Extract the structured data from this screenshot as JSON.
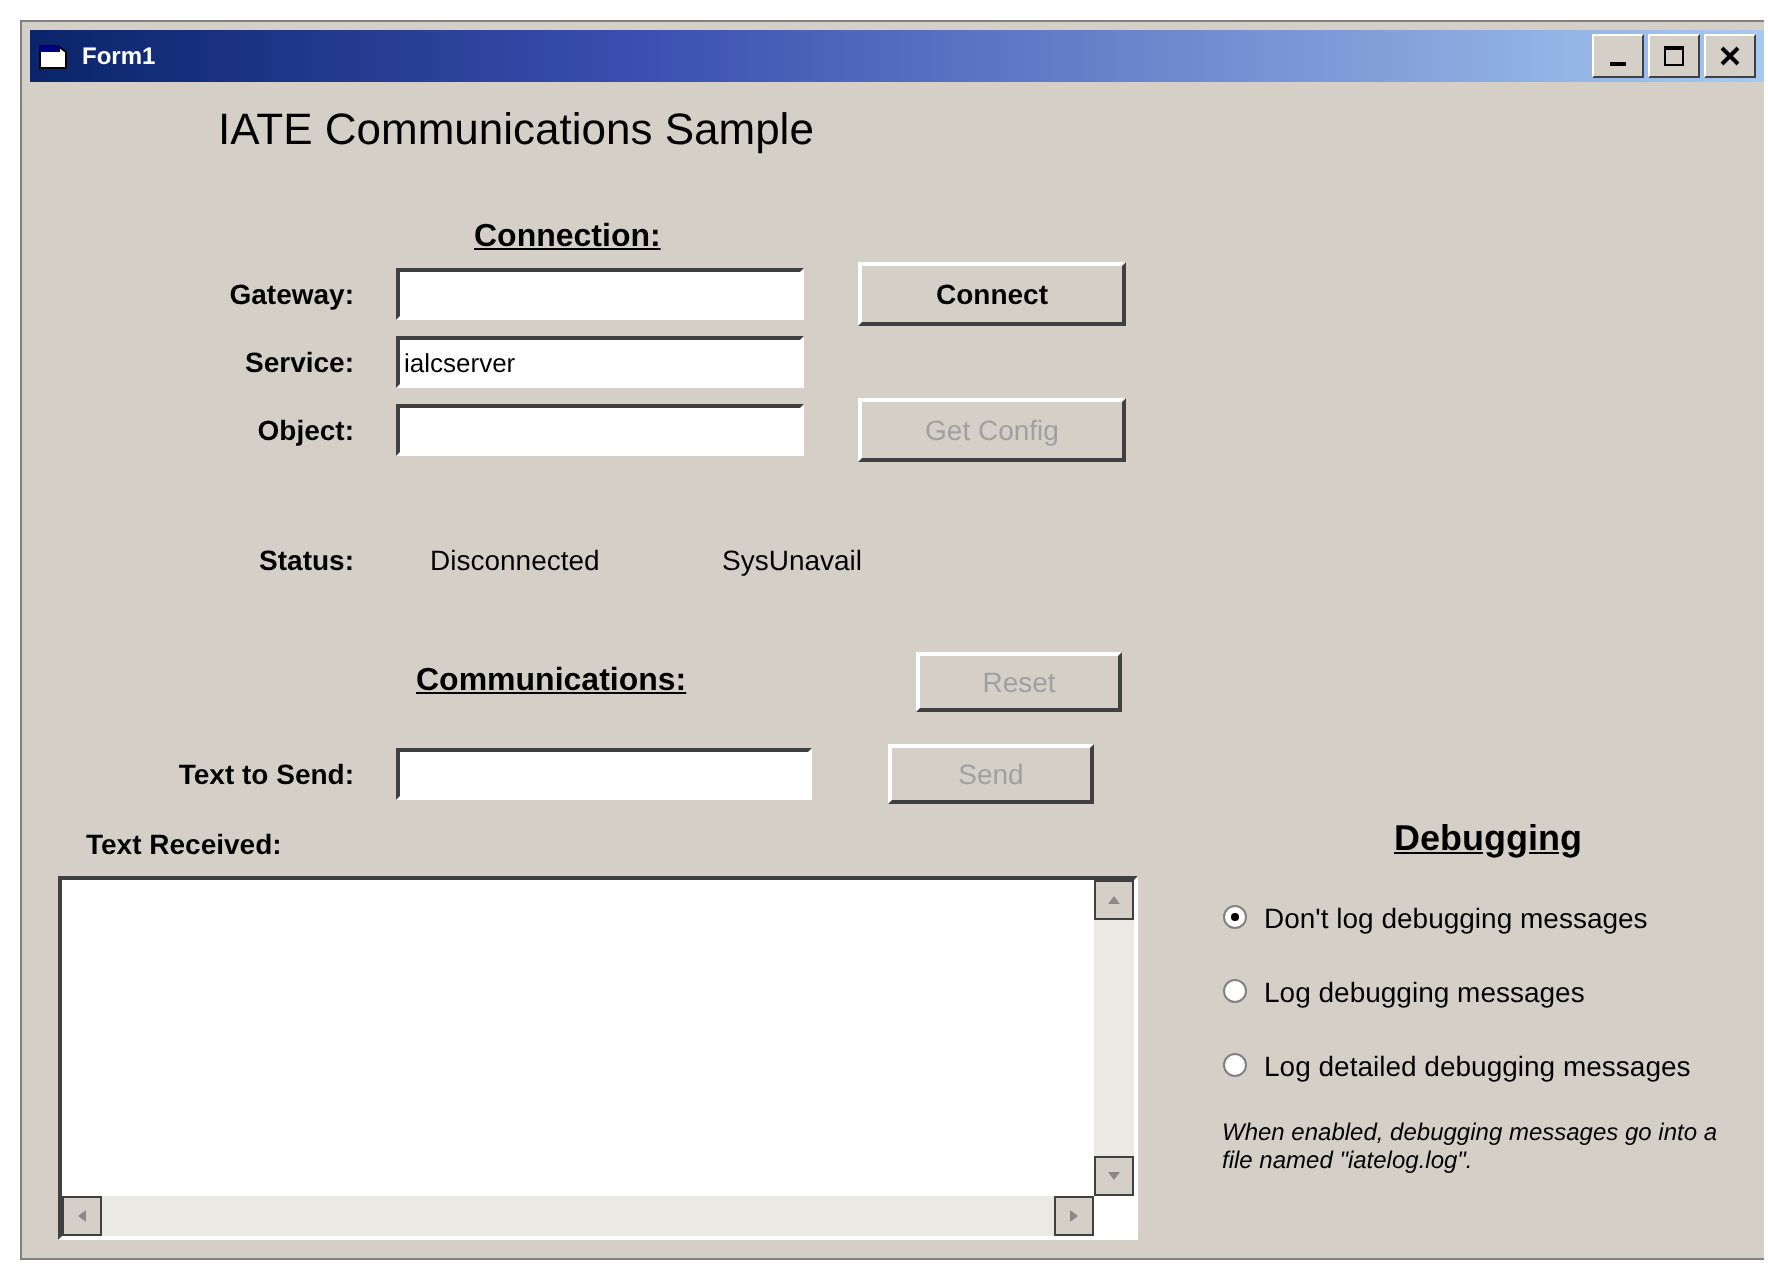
{
  "window": {
    "title": "Form1"
  },
  "heading": "IATE Communications Sample",
  "connection": {
    "heading": "Connection:",
    "fields": [
      {
        "label": "Gateway:",
        "button": {
          "label": "Connect",
          "disabled": false
        }
      },
      {
        "label": "Service:",
        "value": "ialcserver"
      },
      {
        "label": "Object:",
        "button": {
          "label": "Get Config",
          "disabled": true
        }
      }
    ],
    "status": {
      "label": "Status:",
      "state": "Disconnected",
      "detail": "SysUnavail"
    }
  },
  "communications": {
    "heading": "Communications:",
    "reset_button": {
      "label": "Reset",
      "disabled": true
    },
    "send_label": "Text to Send:",
    "send_button": {
      "label": "Send",
      "disabled": true
    },
    "received_label": "Text Received:"
  },
  "debugging": {
    "heading": "Debugging",
    "options": [
      {
        "label": "Don't log debugging messages",
        "selected": true
      },
      {
        "label": "Log debugging messages",
        "selected": false
      },
      {
        "label": "Log detailed debugging messages",
        "selected": false
      }
    ],
    "note": "When enabled, debugging messages go into a file named \"iatelog.log\"."
  }
}
